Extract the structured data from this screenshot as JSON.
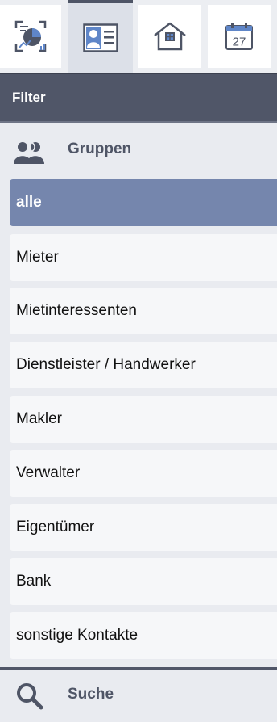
{
  "toolbar": {
    "tools": [
      {
        "name": "reports",
        "icon": "chart-report-icon",
        "active": false
      },
      {
        "name": "contacts",
        "icon": "contact-card-icon",
        "active": true
      },
      {
        "name": "properties",
        "icon": "house-icon",
        "active": false
      },
      {
        "name": "calendar",
        "icon": "calendar-icon",
        "active": false,
        "calendar_day": "27"
      }
    ]
  },
  "filter": {
    "title": "Filter"
  },
  "groups": {
    "title": "Gruppen",
    "icon": "users-icon",
    "items": [
      {
        "label": "alle",
        "active": true
      },
      {
        "label": "Mieter",
        "active": false
      },
      {
        "label": "Mietinteressenten",
        "active": false
      },
      {
        "label": "Dienstleister / Handwerker",
        "active": false
      },
      {
        "label": "Makler",
        "active": false
      },
      {
        "label": "Verwalter",
        "active": false
      },
      {
        "label": "Eigentümer",
        "active": false
      },
      {
        "label": "Bank",
        "active": false
      },
      {
        "label": "sonstige Kontakte",
        "active": false
      }
    ]
  },
  "search": {
    "label": "Suche",
    "icon": "search-icon"
  },
  "colors": {
    "header_bg": "#505668",
    "active_item_bg": "#7586ad",
    "accent_blue": "#5f86c8"
  }
}
